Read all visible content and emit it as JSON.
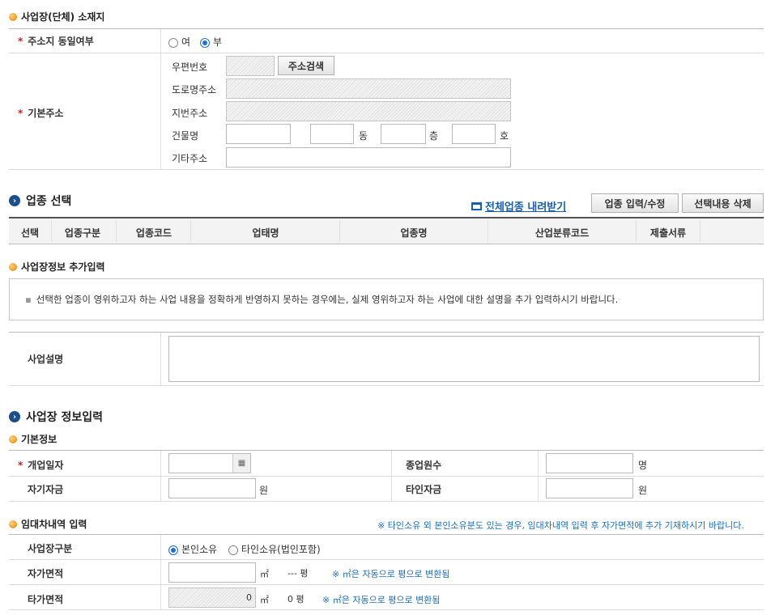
{
  "location": {
    "title": "사업장(단체) 소재지",
    "same_address_label": "주소지 동일여부",
    "same_yes": "여",
    "same_no": "부",
    "basic_address_label": "기본주소",
    "zip_label": "우편번호",
    "search_button": "주소검색",
    "road_label": "도로명주소",
    "jibun_label": "지번주소",
    "building_label": "건물명",
    "dong_unit": "동",
    "floor_unit": "층",
    "ho_unit": "호",
    "other_label": "기타주소"
  },
  "industry": {
    "title": "업종 선택",
    "download_link": "전체업종 내려받기",
    "edit_button": "업종 입력/수정",
    "delete_button": "선택내용 삭제",
    "columns": [
      "선택",
      "업종구분",
      "업종코드",
      "업태명",
      "업종명",
      "산업분류코드",
      "제출서류"
    ]
  },
  "extra": {
    "title": "사업장정보 추가입력",
    "notice": "선택한 업종이 영위하고자 하는 사업 내용을 정확하게 반영하지 못하는 경우에는, 실제 영위하고자 하는 사업에 대한 설명을 추가 입력하시기 바랍니다.",
    "desc_label": "사업설명"
  },
  "business": {
    "title": "사업장 정보입력",
    "basic_title": "기본정보",
    "open_date_label": "개업일자",
    "employees_label": "종업원수",
    "employees_unit": "명",
    "own_capital_label": "자기자금",
    "own_unit": "원",
    "other_capital_label": "타인자금",
    "other_unit": "원"
  },
  "lease": {
    "title": "임대차내역 입력",
    "note": "※ 타인소유 외 본인소유분도 있는 경우, 임대차내역 입력 후 자가면적에 추가 기재하시기 바랍니다.",
    "type_label": "사업장구분",
    "own": "본인소유",
    "other": "타인소유(법인포함)",
    "own_area_label": "자가면적",
    "own_area_unit": "㎡",
    "own_area_pyeong": "--- 평",
    "auto_note": "※ ㎡은 자동으로 평으로 변환됨",
    "other_area_label": "타가면적",
    "other_area_value": "0",
    "other_area_unit": "㎡",
    "other_area_pyeong": "0 평",
    "auto_note2": "※ ㎡은 자동으로 평으로 변환됨"
  }
}
